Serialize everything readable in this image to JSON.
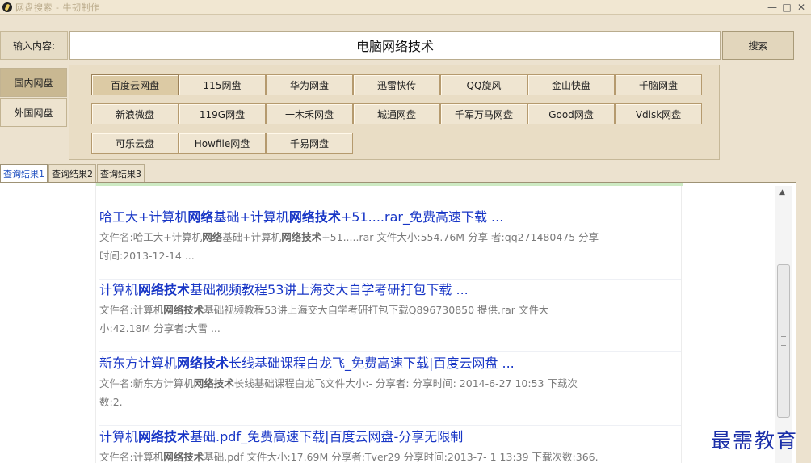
{
  "window": {
    "title": "网盘搜索 - 牛韧制作",
    "minimize": "—",
    "maximize": "□",
    "close": "✕"
  },
  "search": {
    "label": "输入内容:",
    "value": "电脑网络技术",
    "button": "搜索"
  },
  "categories": [
    {
      "label": "国内网盘",
      "active": true
    },
    {
      "label": "外国网盘",
      "active": false
    }
  ],
  "providers": {
    "row1": [
      "百度云网盘",
      "115网盘",
      "华为网盘",
      "迅雷快传",
      "QQ旋风",
      "金山快盘",
      "千脑网盘"
    ],
    "row2": [
      "新浪微盘",
      "119G网盘",
      "一木禾网盘",
      "城通网盘",
      "千军万马网盘",
      "Good网盘",
      "Vdisk网盘"
    ],
    "row3": [
      "可乐云盘",
      "Howfile网盘",
      "千易网盘"
    ]
  },
  "result_tabs": [
    "查询结果1",
    "查询结果2",
    "查询结果3"
  ],
  "results": [
    {
      "title_html": "哈工大+计算机<b>网络</b>基础+计算机<b>网络技术</b>+51....rar_免费高速下载 ...",
      "desc_html": "文件名:哈工大+计算机<b>网络</b>基础+计算机<b>网络技术</b>+51.....rar 文件大小:554.76M 分享 者:qq271480475 分享<br>时间:2013-12-14 ..."
    },
    {
      "title_html": "计算机<b>网络技术</b>基础视频教程53讲上海交大自学考研打包下载 ...",
      "desc_html": "文件名:计算机<b>网络技术</b>基础视频教程53讲上海交大自学考研打包下载Q896730850 提供.rar 文件大<br>小:42.18M 分享者:大雪 ..."
    },
    {
      "title_html": "新东方计算机<b>网络技术</b>长线基础课程白龙飞_免费高速下载|百度云网盘 ...",
      "desc_html": "文件名:新东方计算机<b>网络技术</b>长线基础课程白龙飞文件大小:- 分享者: 分享时间: 2014-6-27 10:53 下载次<br>数:2."
    },
    {
      "title_html": "计算机<b>网络技术</b>基础.pdf_免费高速下载|百度云网盘-分享无限制",
      "desc_html": "文件名:计算机<b>网络技术</b>基础.pdf 文件大小:17.69M 分享者:Tver29 分享时间:2013-7- 1 13:39 下载次数:366."
    }
  ],
  "watermark": "最需教育"
}
